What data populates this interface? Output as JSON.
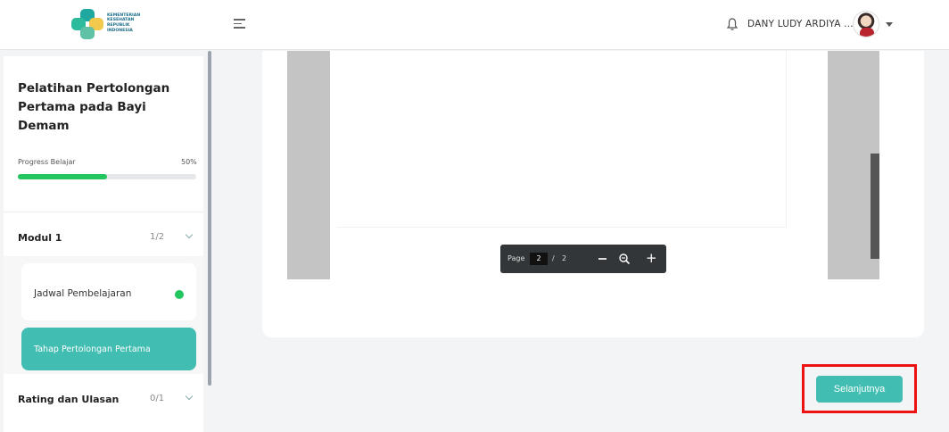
{
  "header": {
    "logo_text": [
      "KEMENTERIAN",
      "KESEHATAN",
      "REPUBLIK",
      "INDONESIA"
    ],
    "user_name": "DANY LUDY ARDIYA ...",
    "icons": [
      "menu-icon",
      "bell-icon",
      "chevron-down-icon"
    ]
  },
  "sidebar": {
    "course_title": "Pelatihan Pertolongan Pertama pada Bayi Demam",
    "progress_label": "Progress Belajar",
    "progress_percent": "50%",
    "progress_fraction": 0.5,
    "modules": [
      {
        "label": "Modul 1",
        "count": "1/2",
        "items": [
          {
            "label": "Jadwal Pembelajaran",
            "completed": true
          },
          {
            "label": "Tahap Pertolongan Pertama",
            "active": true
          }
        ]
      },
      {
        "label": "Rating dan Ulasan",
        "count": "0/1"
      }
    ]
  },
  "pdf_viewer": {
    "page_label": "Page",
    "current_page": "2",
    "separator": "/",
    "total_pages": "2"
  },
  "actions": {
    "next_label": "Selanjutnya"
  },
  "colors": {
    "accent": "#41bdb2",
    "progress": "#22c55e",
    "highlight": "#ee1111"
  }
}
